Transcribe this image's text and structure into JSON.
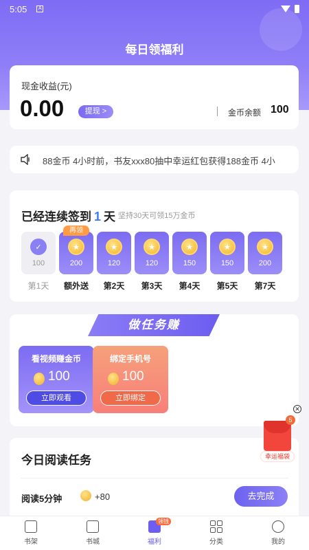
{
  "status": {
    "time": "5:05",
    "a_icon": "A"
  },
  "header": {
    "title": "每日领福利"
  },
  "cash": {
    "label": "现金收益(元)",
    "amount": "0.00",
    "withdraw": "提现 >",
    "coin_label": "金币余额",
    "coin_value": "100"
  },
  "marquee": {
    "text": "88金币  4小时前，书友xxx80抽中幸运红包获得188金币  4小"
  },
  "signin": {
    "title_prefix": "已经连续签到",
    "days": "1",
    "title_suffix": "天",
    "subtitle": "坚持30天可领15万金币",
    "items": [
      {
        "name": "第1天",
        "amount": "100",
        "done": true,
        "tag": ""
      },
      {
        "name": "额外送",
        "amount": "200",
        "done": false,
        "tag": "再领"
      },
      {
        "name": "第2天",
        "amount": "120",
        "done": false,
        "tag": ""
      },
      {
        "name": "第3天",
        "amount": "120",
        "done": false,
        "tag": ""
      },
      {
        "name": "第4天",
        "amount": "150",
        "done": false,
        "tag": ""
      },
      {
        "name": "第5天",
        "amount": "150",
        "done": false,
        "tag": ""
      },
      {
        "name": "第7天",
        "amount": "200",
        "done": false,
        "tag": ""
      }
    ]
  },
  "tasks": {
    "banner": "做任务赚",
    "cards": [
      {
        "title": "看视频赚金币",
        "value": "100",
        "button": "立即观看"
      },
      {
        "title": "绑定手机号",
        "value": "100",
        "button": "立即绑定"
      }
    ]
  },
  "reading": {
    "title": "今日阅读任务",
    "task": "阅读5分钟",
    "reward": "+80",
    "button": "去完成"
  },
  "lucky": {
    "badge": "5",
    "label": "幸运福袋"
  },
  "tabbar": {
    "items": [
      {
        "label": "书架"
      },
      {
        "label": "书城"
      },
      {
        "label": "福利",
        "badge": "领钱"
      },
      {
        "label": "分类"
      },
      {
        "label": "我的"
      }
    ]
  }
}
